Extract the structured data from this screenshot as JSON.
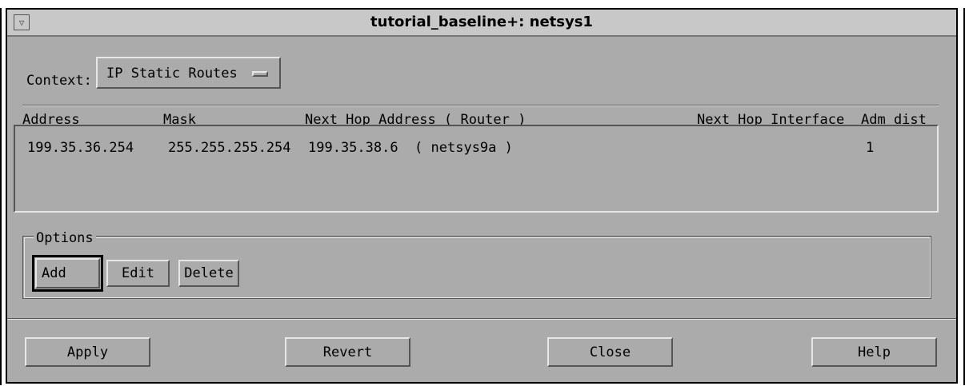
{
  "window": {
    "title": "tutorial_baseline+: netsys1",
    "menu_icon": "window-menu-icon"
  },
  "context": {
    "label": "Context:",
    "selected": "IP Static Routes",
    "dropdown_icon": "option-menu-indicator-icon"
  },
  "table": {
    "columns": [
      "Address",
      "Mask",
      "Next Hop Address ( Router )",
      "Next Hop Interface",
      "Adm dist"
    ],
    "rows": [
      {
        "address": "199.35.36.254",
        "mask": "255.255.255.254",
        "next_hop": "199.35.38.6  ( netsys9a )",
        "interface": "",
        "adm_dist": "1"
      }
    ]
  },
  "options": {
    "legend": "Options",
    "add_label": "Add",
    "edit_label": "Edit",
    "delete_label": "Delete"
  },
  "footer": {
    "apply_label": "Apply",
    "revert_label": "Revert",
    "close_label": "Close",
    "help_label": "Help"
  }
}
